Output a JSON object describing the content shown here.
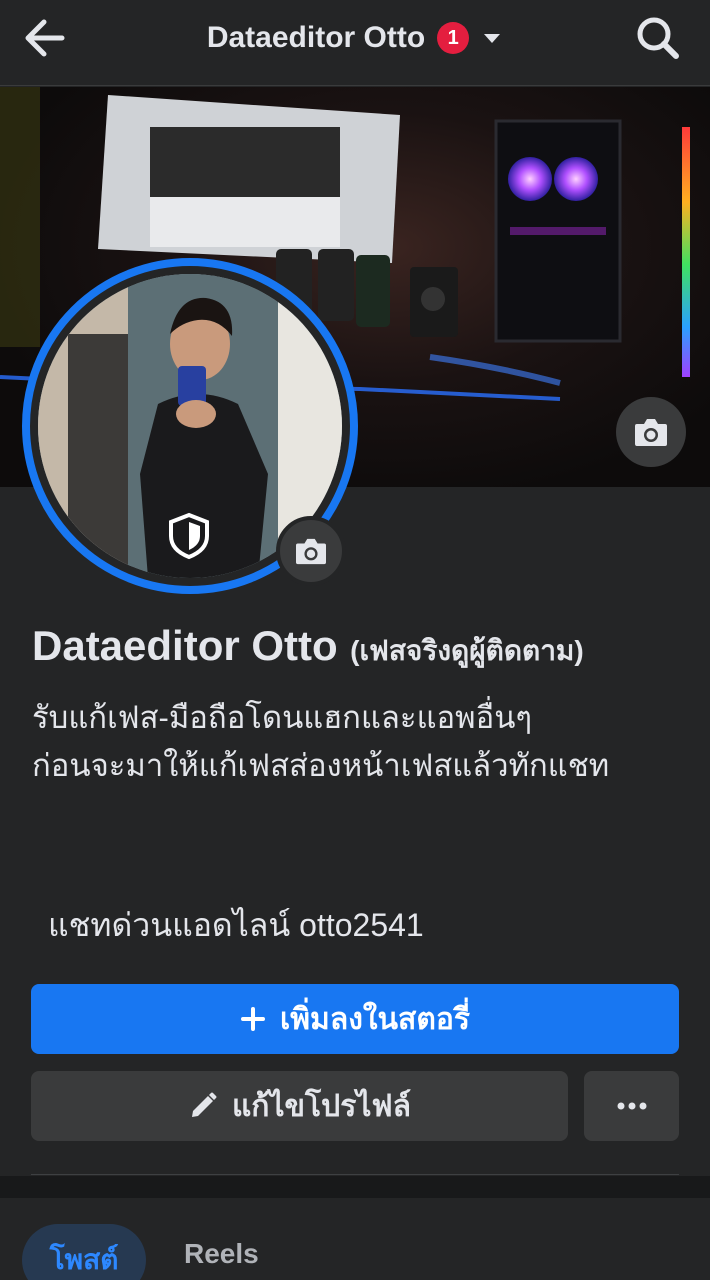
{
  "header": {
    "title": "Dataeditor Otto",
    "notification_count": "1"
  },
  "profile": {
    "name": "Dataeditor Otto",
    "name_suffix": "(เฟสจริงดูผู้ติดตาม)",
    "bio_line1": "รับแก้เฟส-มือถือโดนแฮกและแอพอื่นๆ",
    "bio_line2": "ก่อนจะมาให้แก้เฟสส่องหน้าเฟสแล้วทักแชท",
    "contact": "แชทด่วนแอดไลน์ otto2541"
  },
  "actions": {
    "add_story_label": "เพิ่มลงในสตอรี่",
    "edit_profile_label": "แก้ไขโปรไฟล์"
  },
  "tabs": [
    {
      "label": "โพสต์",
      "active": true
    },
    {
      "label": "Reels",
      "active": false
    }
  ],
  "colors": {
    "accent": "#1877f2",
    "background": "#242526",
    "badge": "#e41e3f"
  },
  "icons": {
    "back": "arrow-left-icon",
    "search": "search-icon",
    "dropdown": "caret-down-icon",
    "camera": "camera-icon",
    "shield": "shield-icon",
    "plus": "plus-icon",
    "pencil": "pencil-icon",
    "more": "more-icon"
  }
}
